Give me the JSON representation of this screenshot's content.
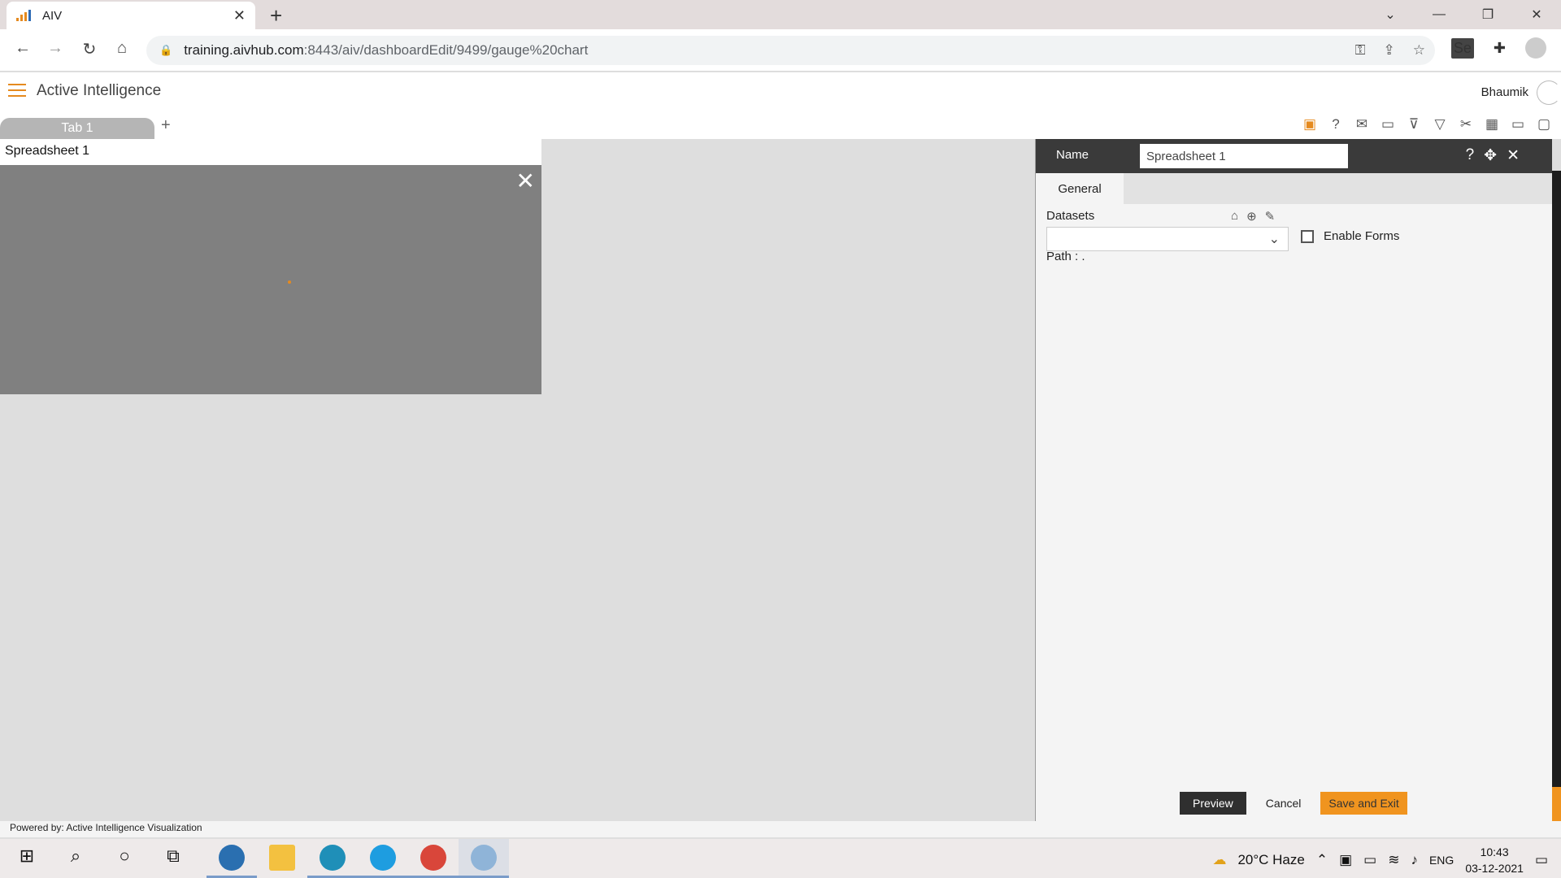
{
  "browser": {
    "tab_title": "AIV",
    "url_host": "training.aivhub.com",
    "url_rest": ":8443/aiv/dashboardEdit/9499/gauge%20chart",
    "se_badge": "Se"
  },
  "app": {
    "title": "Active Intelligence",
    "user": "Bhaumik"
  },
  "dashboard": {
    "tab_label": "Tab 1",
    "widget_title": "Spreadsheet 1"
  },
  "panel": {
    "name_label": "Name",
    "name_value": "Spreadsheet 1",
    "tab_general": "General",
    "datasets_label": "Datasets",
    "enable_forms_label": "Enable Forms",
    "path_label": "Path :  .",
    "preview_label": "Preview",
    "cancel_label": "Cancel",
    "save_label": "Save and Exit"
  },
  "footer": {
    "powered_by": "Powered by: Active Intelligence Visualization"
  },
  "taskbar": {
    "weather": "20°C  Haze",
    "lang": "ENG",
    "time": "10:43",
    "date": "03-12-2021"
  },
  "colors": {
    "accent": "#f0941f",
    "panel_header": "#3a3a3a",
    "widget_body": "#808080"
  }
}
